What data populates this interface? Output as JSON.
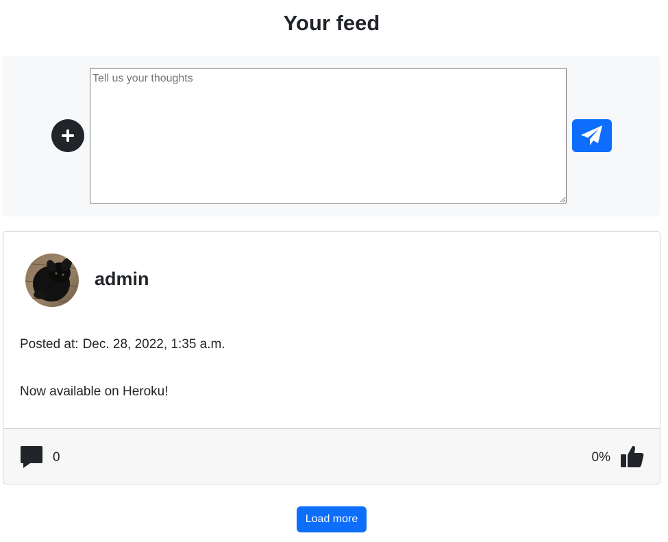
{
  "page": {
    "title": "Your feed"
  },
  "composer": {
    "placeholder": "Tell us your thoughts",
    "value": "",
    "add_icon": "plus-circle-icon",
    "send_icon": "paper-plane-icon",
    "accent_color": "#0d6efd"
  },
  "post": {
    "author": "admin",
    "avatar_icon": "black-dog-avatar",
    "posted_label": "Posted at:",
    "posted_at": "Dec. 28, 2022, 1:35 a.m.",
    "content": "Now available on Heroku!",
    "comment_icon": "comment-icon",
    "comment_count": "0",
    "like_percentage": "0%",
    "like_icon": "thumbs-up-icon"
  },
  "feed": {
    "load_more_label": "Load more"
  }
}
